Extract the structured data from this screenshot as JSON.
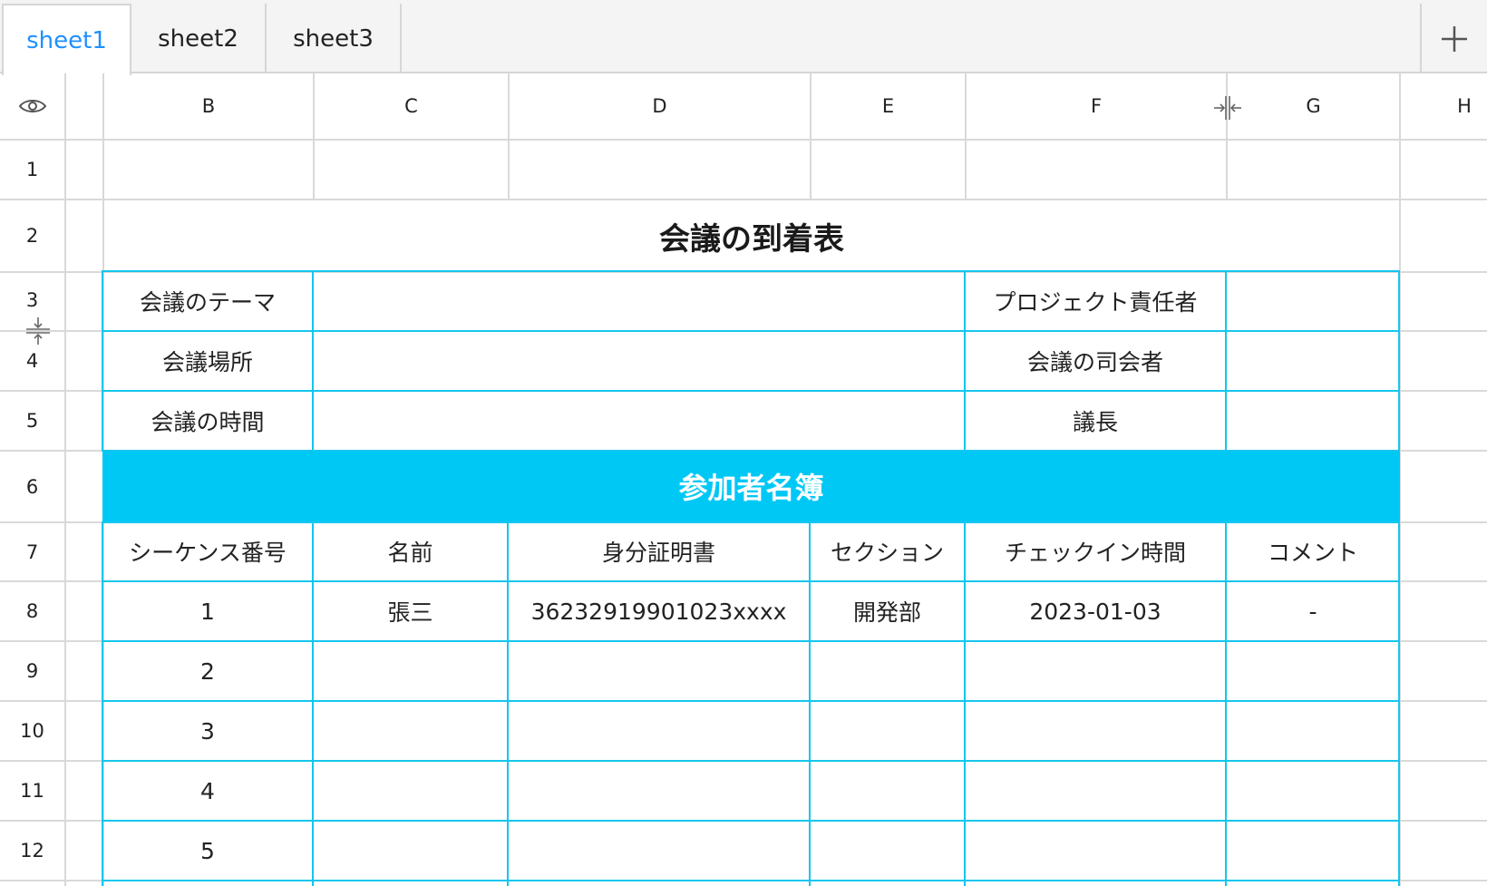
{
  "tabs": [
    "sheet1",
    "sheet2",
    "sheet3"
  ],
  "active_tab": "sheet1",
  "add_tab_icon": "plus-icon",
  "visibility_icon": "eye-icon",
  "column_headers": [
    "B",
    "C",
    "D",
    "E",
    "F",
    "G",
    "H"
  ],
  "row_headers": [
    "1",
    "2",
    "3",
    "4",
    "5",
    "6",
    "7",
    "8",
    "9",
    "10",
    "11",
    "12"
  ],
  "colors": {
    "accent": "#1e90ff",
    "table_border": "#14c6ee",
    "banner_background": "#00c8f5",
    "banner_text": "#ffffff",
    "grid_line": "#d9d9d9"
  },
  "sheet": {
    "title": "会議の到着表",
    "info": {
      "theme_label": "会議のテーマ",
      "location_label": "会議場所",
      "time_label": "会議の時間",
      "owner_label": "プロジェクト責任者",
      "host_label": "会議の司会者",
      "chair_label": "議長"
    },
    "banner": "参加者名簿",
    "table_headers": [
      "シーケンス番号",
      "名前",
      "身分証明書",
      "セクション",
      "チェックイン時間",
      "コメント"
    ],
    "rows": [
      [
        "1",
        "張三",
        "36232919901023xxxx",
        "開発部",
        "2023-01-03",
        "-"
      ],
      [
        "2",
        "",
        "",
        "",
        "",
        ""
      ],
      [
        "3",
        "",
        "",
        "",
        "",
        ""
      ],
      [
        "4",
        "",
        "",
        "",
        "",
        ""
      ],
      [
        "5",
        "",
        "",
        "",
        "",
        ""
      ]
    ]
  }
}
